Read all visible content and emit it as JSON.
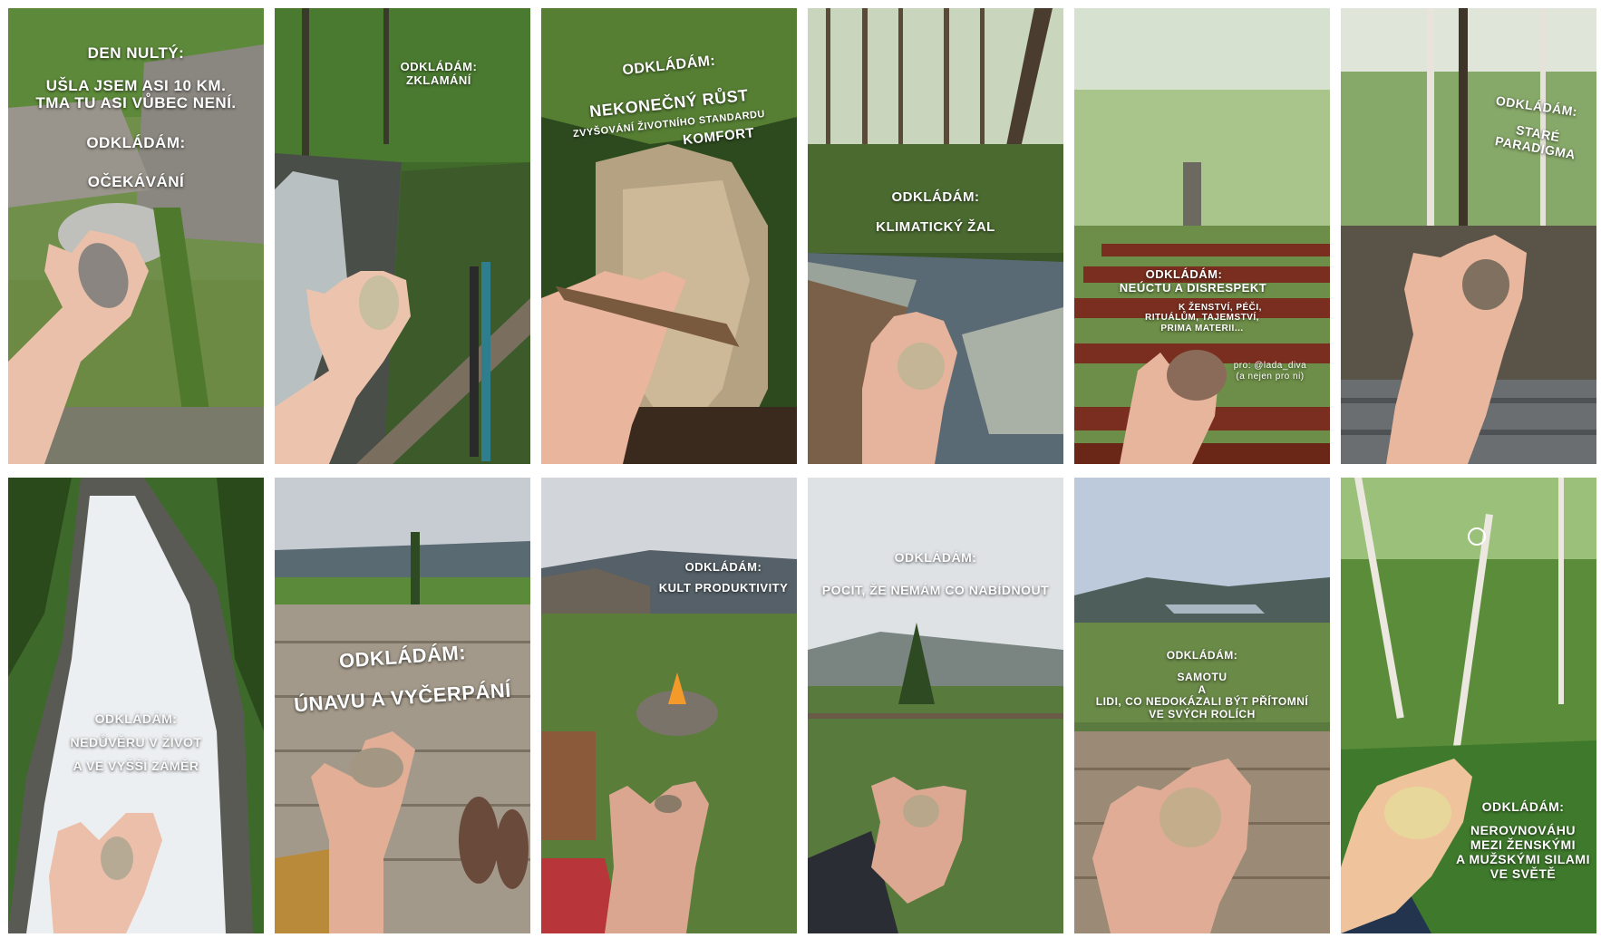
{
  "tiles": [
    {
      "lines": [
        "DEN NULTÝ:",
        "UŠLA JSEM ASI 10 KM.",
        "TMA TU ASI VŮBEC NENÍ.",
        "ODKLÁDÁM:",
        "OČEKÁVÁNÍ"
      ]
    },
    {
      "lines": [
        "ODKLÁDÁM:",
        "ZKLAMÁNÍ"
      ]
    },
    {
      "lines": [
        "ODKLÁDÁM:",
        "NEKONEČNÝ RŮST",
        "ZVYŠOVÁNÍ ŽIVOTNÍHO STANDARDU",
        "KOMFORT"
      ]
    },
    {
      "lines": [
        "ODKLÁDÁM:",
        "KLIMATICKÝ ŽAL"
      ]
    },
    {
      "lines": [
        "ODKLÁDÁM:",
        "NEÚCTU A DISRESPEKT",
        "K ŽENSTVÍ, PÉČI,",
        "RITUÁLŮM, TAJEMSTVÍ,",
        "PRIMA MATERII...",
        "pro: @lada_diva",
        "(a nejen pro ni)"
      ]
    },
    {
      "lines": [
        "ODKLÁDÁM:",
        "STARÉ PARADIGMA"
      ]
    },
    {
      "lines": [
        "ODKLÁDÁM:",
        "NEDŮVĚRU V ŽIVOT",
        "A VE VYŠŠÍ ZÁMĚR"
      ]
    },
    {
      "lines": [
        "ODKLÁDÁM:",
        "ÚNAVU A VYČERPÁNÍ"
      ]
    },
    {
      "lines": [
        "ODKLÁDÁM:",
        "KULT PRODUKTIVITY"
      ]
    },
    {
      "lines": [
        "ODKLÁDÁM:",
        "POCIT, ŽE NEMÁM CO NABÍDNOUT"
      ]
    },
    {
      "lines": [
        "ODKLÁDÁM:",
        "SAMOTU",
        "A",
        "LIDI, CO NEDOKÁZALI BÝT PŘÍTOMNÍ",
        "VE SVÝCH ROLÍCH"
      ]
    },
    {
      "lines": [
        "ODKLÁDÁM:",
        "NEROVNOVÁHU",
        "MEZI ŽENSKÝMI",
        "A MUŽSKÝMI SILAMI",
        "VE SVĚTĚ"
      ]
    }
  ],
  "colors": {
    "forest_dark": "#2f4a22",
    "forest_mid": "#4e7a32",
    "grass": "#5d8f3a",
    "sky_overcast": "#d9dde2",
    "sky_blue": "#b7cbe0",
    "rock": "#8b8578",
    "water": "#e8ecef",
    "wood": "#8a7a66",
    "bench_red": "#7a2e1f",
    "skin": "#e8b8a0",
    "stone_light": "#c9b99c",
    "text": "#ffffff"
  }
}
